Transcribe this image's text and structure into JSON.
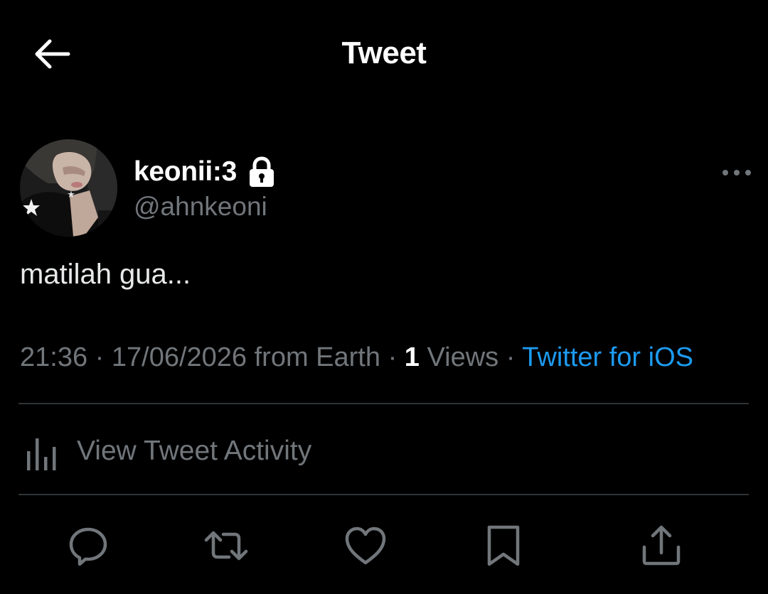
{
  "header": {
    "title": "Tweet",
    "back_icon": "arrow-left-icon"
  },
  "author": {
    "display_name": "keonii:3",
    "handle": "@ahnkeoni",
    "protected_icon": "lock-icon"
  },
  "more_icon": "more-horizontal-icon",
  "tweet": {
    "text": "matilah gua..."
  },
  "meta": {
    "time": "21:36",
    "sep1": " · ",
    "date": "17/06/2026",
    "location": " from Earth",
    "sep2": " · ",
    "views_count": "1",
    "views_label": " Views",
    "sep3": " · ",
    "source": "Twitter for iOS"
  },
  "activity": {
    "label": "View Tweet Activity",
    "icon": "bar-chart-icon"
  },
  "actions": [
    {
      "icon": "reply-icon"
    },
    {
      "icon": "retweet-icon"
    },
    {
      "icon": "like-icon"
    },
    {
      "icon": "bookmark-icon"
    },
    {
      "icon": "share-icon"
    }
  ],
  "colors": {
    "background": "#000000",
    "text": "#ffffff",
    "secondary": "#71767b",
    "link": "#1d9bf0",
    "divider": "#2f3336"
  }
}
